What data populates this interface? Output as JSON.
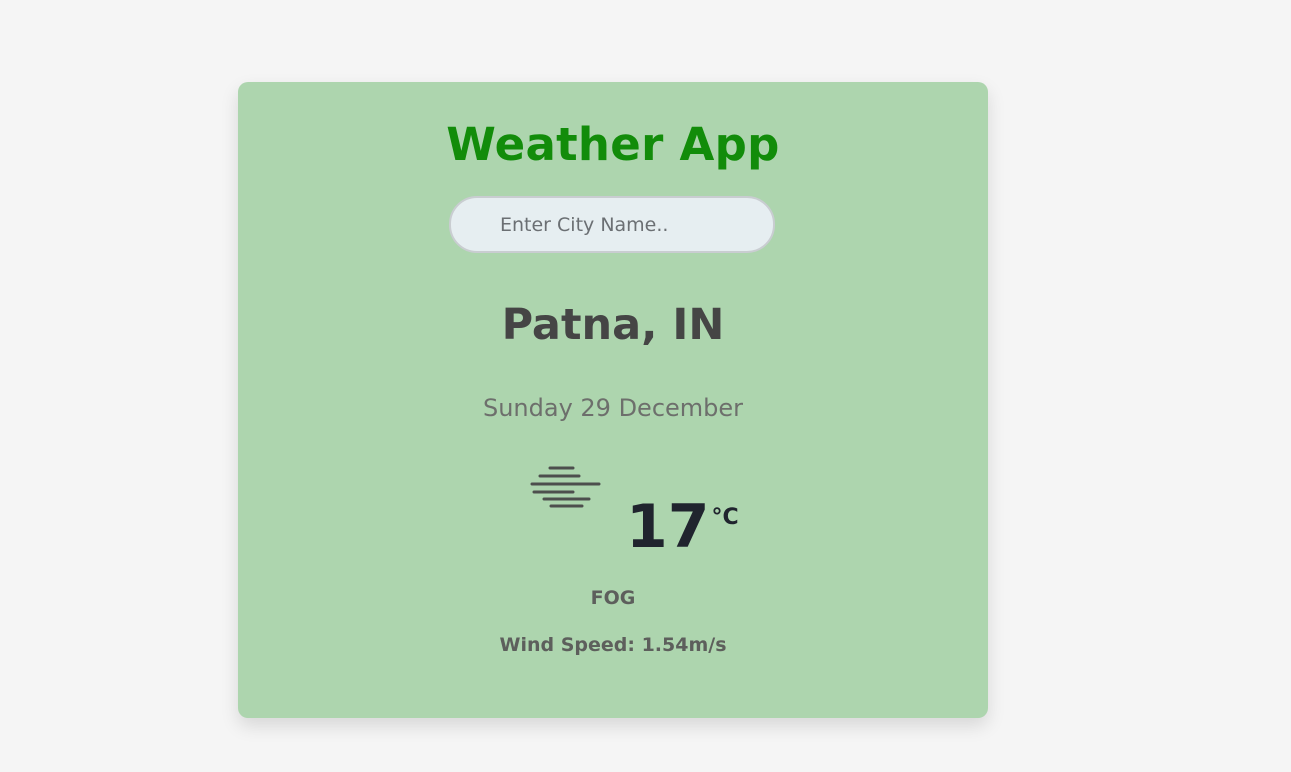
{
  "app": {
    "title": "Weather App"
  },
  "search": {
    "placeholder": "Enter City Name..",
    "value": ""
  },
  "weather": {
    "location": "Patna, IN",
    "date": "Sunday 29 December",
    "icon": "fog-icon",
    "temperature": "17",
    "unit": "°C",
    "condition": "FOG",
    "wind_label": "Wind Speed: ",
    "wind_value": "1.54m/s"
  },
  "colors": {
    "page_background": "#f5f5f5",
    "card_background": "#add5ae",
    "title": "#128c0a",
    "input_background": "#e6eef1",
    "text_dark": "#454545",
    "temperature": "#20242e",
    "secondary_text": "#6d6f6c",
    "icon": "#4d4f4d"
  }
}
